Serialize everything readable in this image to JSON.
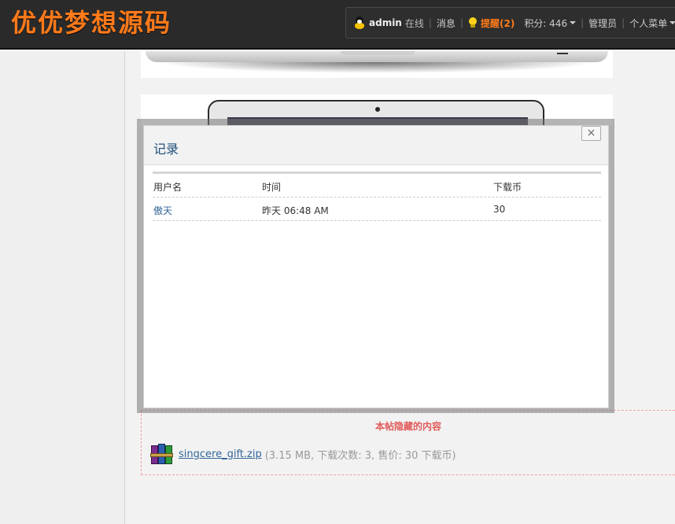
{
  "header": {
    "logo_text": "优优梦想源码",
    "user": "admin",
    "status": "在线",
    "messages": "消息",
    "remind": "提醒(2)",
    "points": "积分: 446",
    "admin": "管理员",
    "personal_menu": "个人菜单"
  },
  "modal": {
    "title": "记录",
    "close_label": "×",
    "columns": [
      "用户名",
      "时间",
      "下载币"
    ],
    "rows": [
      {
        "user": "傲天",
        "time": "昨天 06:48 AM",
        "coins": "30"
      }
    ]
  },
  "hidden_content": {
    "title": "本帖隐藏的内容",
    "file_name": "singcere_gift.zip",
    "file_meta": "(3.15 MB, 下载次数: 3, 售价: 30 下载币)"
  },
  "colors": {
    "logo": "#ff7a1a",
    "link": "#336699",
    "hidden_title": "#e05a5a"
  },
  "icons": [
    "qq-icon",
    "bulb-icon",
    "close-icon",
    "rar-file-icon",
    "caret-down-icon"
  ]
}
